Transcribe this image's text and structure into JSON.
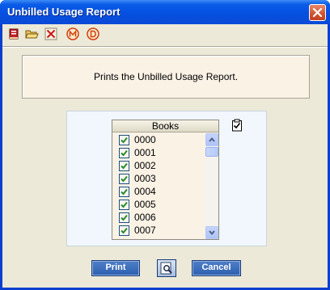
{
  "window": {
    "title": "Unbilled Usage Report"
  },
  "toolbar": {
    "icons": [
      "report-book-icon",
      "open-folder-icon",
      "clear-x-icon",
      "m-circle-icon",
      "d-circle-icon"
    ]
  },
  "info": {
    "text": "Prints the Unbilled Usage Report."
  },
  "books": {
    "header": "Books",
    "items": [
      {
        "label": "0000",
        "checked": true
      },
      {
        "label": "0001",
        "checked": true
      },
      {
        "label": "0002",
        "checked": true
      },
      {
        "label": "0003",
        "checked": true
      },
      {
        "label": "0004",
        "checked": true
      },
      {
        "label": "0005",
        "checked": true
      },
      {
        "label": "0006",
        "checked": true
      },
      {
        "label": "0007",
        "checked": true
      }
    ]
  },
  "buttons": {
    "print": "Print",
    "cancel": "Cancel"
  },
  "colors": {
    "titlebar": "#0550e0",
    "panel": "#fbf2e6",
    "button": "#2d5fae",
    "check": "#2a8c2a"
  }
}
